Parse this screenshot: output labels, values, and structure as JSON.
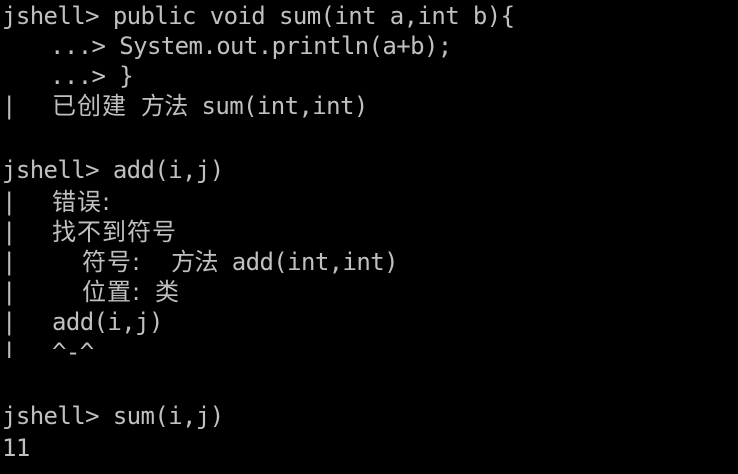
{
  "terminal": {
    "background": "#000000",
    "foreground": "#c0c0c0",
    "blocks": [
      {
        "prompt": "jshell>",
        "command": "public void sum(int a,int b){",
        "continuations": [
          {
            "prompt": "...>",
            "text": "System.out.println(a+b);"
          },
          {
            "prompt": "...>",
            "text": "}"
          }
        ],
        "output": {
          "pipe": "|",
          "label": "已创建",
          "text": "方法 sum(int,int)"
        }
      },
      {
        "prompt": "jshell>",
        "command": "add(i,j)",
        "error": {
          "pipe": "|",
          "title": "错误:",
          "message": "找不到符号",
          "symbol_label": "符号:",
          "symbol_value": "方法 add(int,int)",
          "location_label": "位置:",
          "location_value": "类",
          "code": "add(i,j)",
          "marker": "^-^"
        }
      },
      {
        "prompt": "jshell>",
        "command": "sum(i,j)",
        "result": "11"
      }
    ]
  }
}
